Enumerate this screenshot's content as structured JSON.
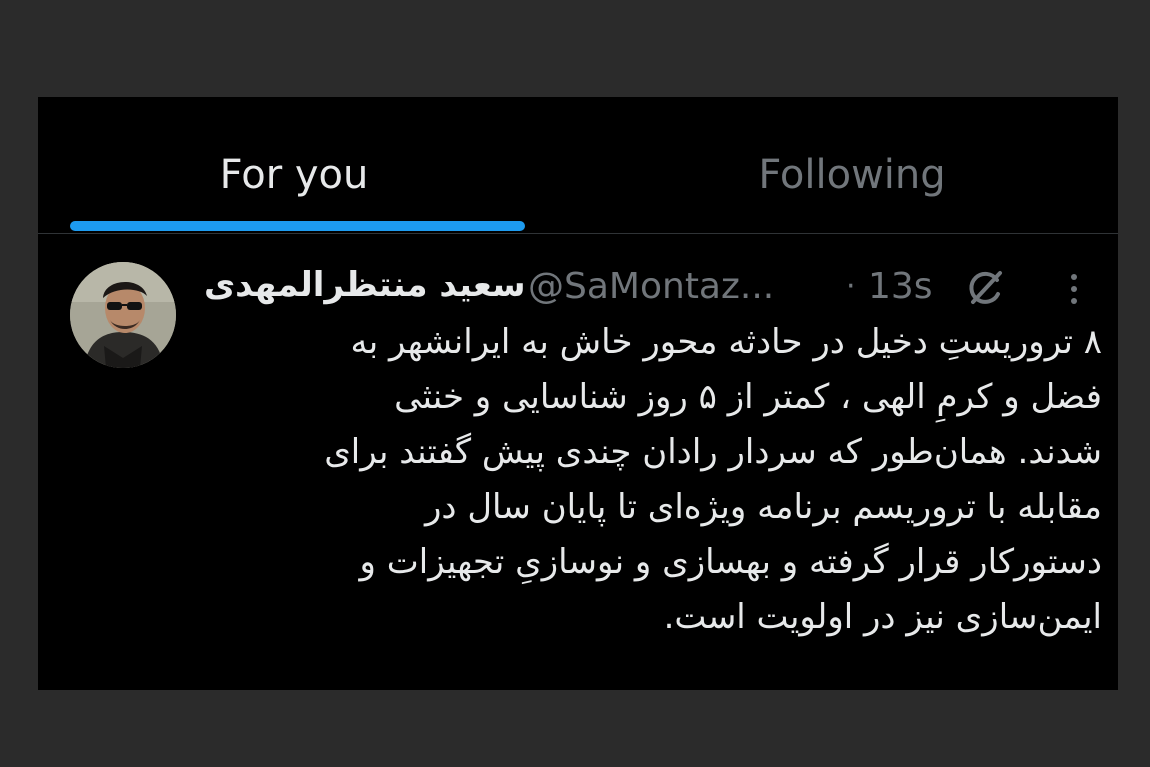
{
  "tabs": [
    {
      "label": "For you",
      "active": true
    },
    {
      "label": "Following",
      "active": false
    }
  ],
  "tweet": {
    "display_name": "سعید منتظرالمهدی",
    "handle": "@SaMontaz...",
    "separator": "·",
    "timestamp": "13s",
    "icons": [
      "avatar-photo",
      "grok-icon",
      "more-options-icon"
    ],
    "text": "۸ تروریستِ دخیل در حادثه محور خاش به ایرانشهر به\nفضل و کرمِ الهی ، کمتر از ۵ روز شناسایی و خنثی\nشدند. همان‌طور که سردار رادان چندی پیش گفتند برای\nمقابله با تروریسم برنامه ویژه‌ای تا پایان سال در\nدستورکار قرار گرفته و بهسازی و نوسازیِ تجهیزات و\nایمن‌سازی نیز در اولویت است."
  },
  "colors": {
    "background": "#000000",
    "outer_background": "#2b2b2b",
    "accent": "#1d9bf0",
    "primary_text": "#e7e9ea",
    "secondary_text": "#71767b"
  }
}
